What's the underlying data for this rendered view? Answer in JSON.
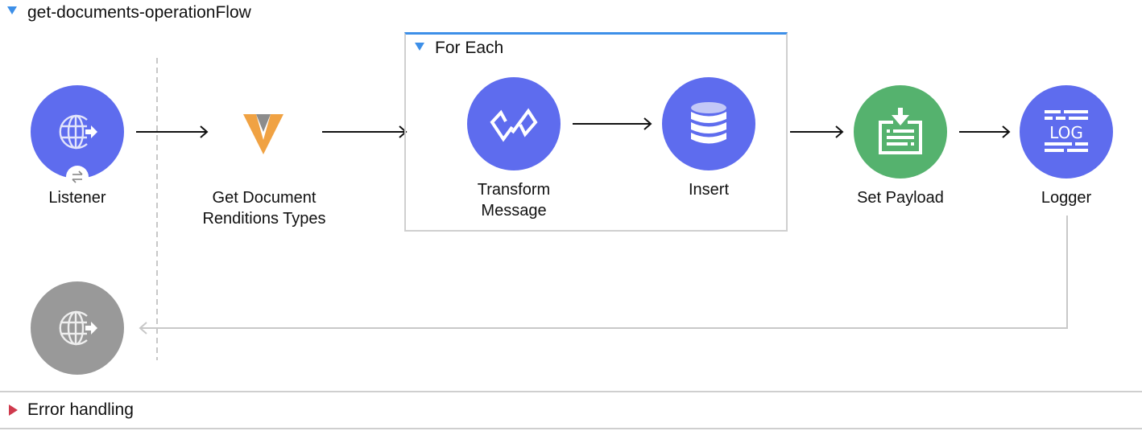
{
  "flow": {
    "title": "get-documents-operationFlow",
    "expand_icon": "triangle-down-icon"
  },
  "nodes": [
    {
      "id": "listener",
      "label_lines": [
        "Listener"
      ],
      "icon": "globe-arrow-icon",
      "color": "#5e6cee"
    },
    {
      "id": "get-document-renditions-types",
      "label_lines": [
        "Get Document",
        "Renditions Types"
      ],
      "icon": "veeva-v-icon",
      "color": "#f0a243"
    },
    {
      "id": "transform-message",
      "label_lines": [
        "Transform",
        "Message"
      ],
      "icon": "dataweave-icon",
      "color": "#5e6cee"
    },
    {
      "id": "insert",
      "label_lines": [
        "Insert"
      ],
      "icon": "database-icon",
      "color": "#5e6cee"
    },
    {
      "id": "set-payload",
      "label_lines": [
        "Set Payload"
      ],
      "icon": "set-payload-icon",
      "color": "#55b26e"
    },
    {
      "id": "logger",
      "label_lines": [
        "Logger"
      ],
      "icon": "log-icon",
      "color": "#5e6cee"
    }
  ],
  "scope": {
    "title": "For Each",
    "expand_icon": "triangle-down-icon",
    "accent": "#3d8fe8"
  },
  "response_node": {
    "icon": "globe-arrow-icon",
    "color": "#999999"
  },
  "error_handling": {
    "label": "Error handling",
    "expand_icon": "triangle-right-icon",
    "color": "#cf3a4d"
  }
}
